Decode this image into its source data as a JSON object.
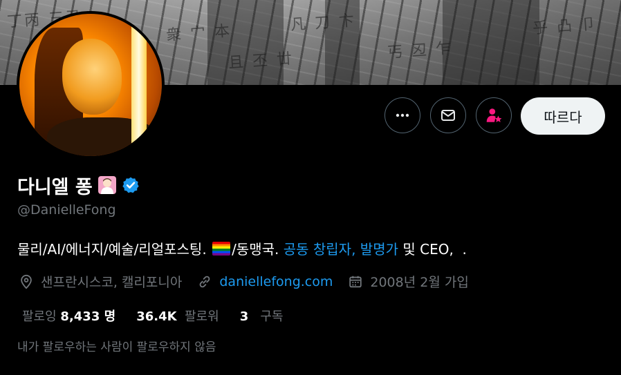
{
  "profile": {
    "display_name": "다니엘 퐁",
    "handle": "@DanielleFong",
    "verified_icon": "verified-badge-icon",
    "name_emoji": "woman-scientist-emoji"
  },
  "actions": {
    "more_icon": "more-icon",
    "message_icon": "mail-icon",
    "subscribe_icon": "subscribe-person-star-icon",
    "follow_label": "따르다"
  },
  "bio": {
    "part1": "물리/AI/에너지/예술/리얼포스팅. ",
    "flag_icon": "rainbow-flag-icon",
    "part2": "/동맹국. ",
    "link1": "공동 창립자, 발명가",
    "part3": " 및 CEO,  ."
  },
  "meta": {
    "location": "샌프란시스코, 캘리포니아",
    "url": "daniellefong.com",
    "joined": "2008년 2월 가입"
  },
  "stats": {
    "following_label": "팔로잉",
    "following_count": "8,433 명",
    "followers_count": "36.4K",
    "followers_label": "팔로워",
    "subscriptions_count": "3",
    "subscriptions_label": "구독"
  },
  "note": "내가 팔로우하는 사람이 팔로우하지 않음",
  "colors": {
    "background": "#000000",
    "accent_blue": "#1d9bf0",
    "subscribe_pink": "#f91880",
    "muted_text": "#71767b",
    "border": "#536471"
  }
}
